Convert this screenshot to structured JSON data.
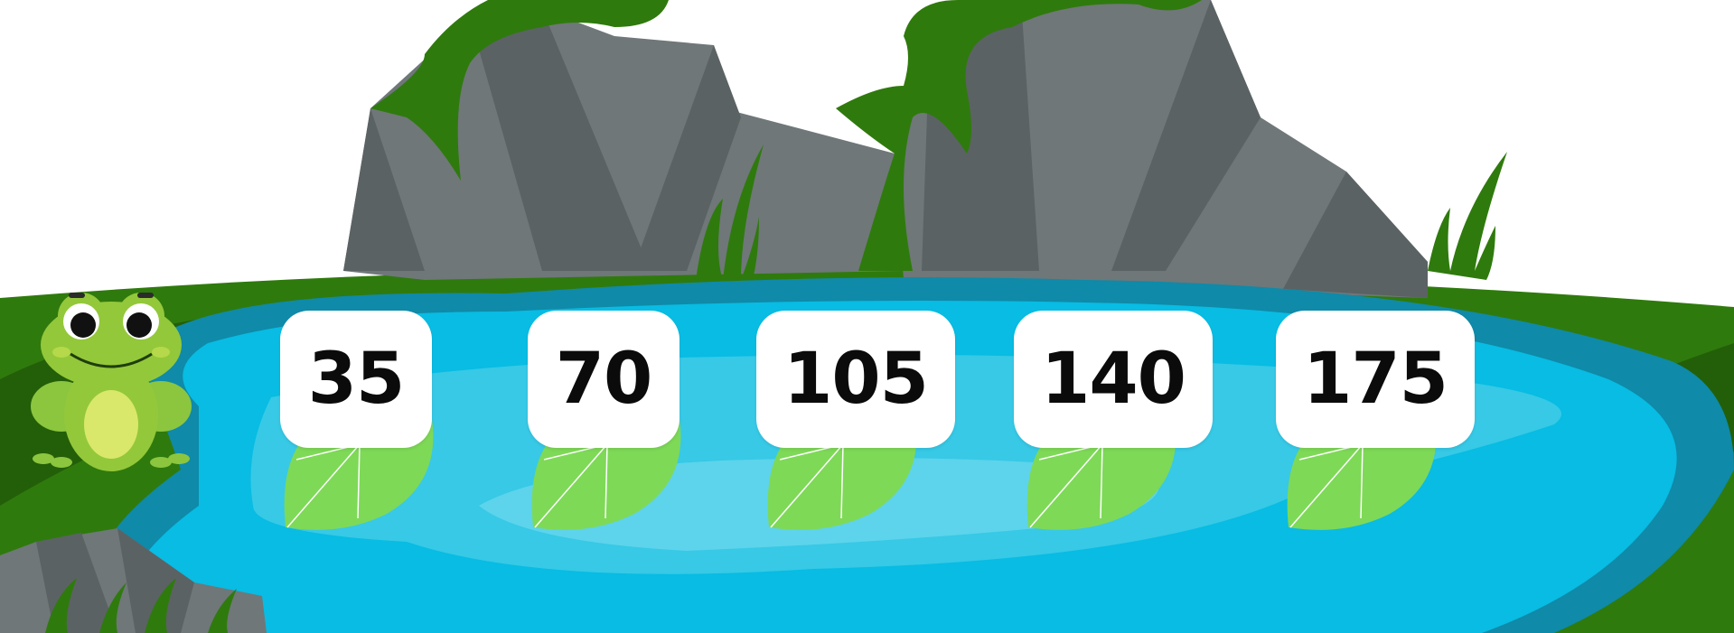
{
  "game": {
    "lily_pads": [
      {
        "number": "35"
      },
      {
        "number": "70"
      },
      {
        "number": "105"
      },
      {
        "number": "140"
      },
      {
        "number": "175"
      }
    ]
  },
  "characters": {
    "frog": "frog-icon"
  },
  "colors": {
    "water": "#08bce3",
    "water_light": "#37c9e6",
    "water_highlight": "#5dd4ec",
    "pond_edge": "#0f8aa8",
    "grass": "#2f7a0d",
    "grass_dark": "#1e5a06",
    "rock": "#6f7779",
    "rock_dark": "#5b6264",
    "leaf": "#7ed957",
    "frog_green": "#93c83a"
  }
}
